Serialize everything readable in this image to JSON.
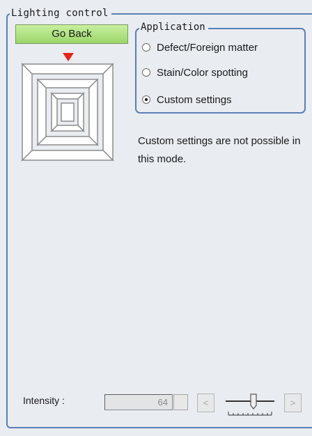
{
  "lighting_control": {
    "title": "Lighting control",
    "go_back_label": "Go Back"
  },
  "application": {
    "title": "Application",
    "options": [
      {
        "label": "Defect/Foreign matter",
        "selected": false
      },
      {
        "label": "Stain/Color spotting",
        "selected": false
      },
      {
        "label": "Custom settings",
        "selected": true
      }
    ]
  },
  "note": "Custom settings are not possible in this mode.",
  "intensity": {
    "label": "Intensity :",
    "value": "64",
    "decrease_label": "<",
    "increase_label": ">"
  },
  "colors": {
    "go_back": "#9cd66a",
    "group_border": "#5a7fb6",
    "selected_marker": "#e8231a"
  }
}
